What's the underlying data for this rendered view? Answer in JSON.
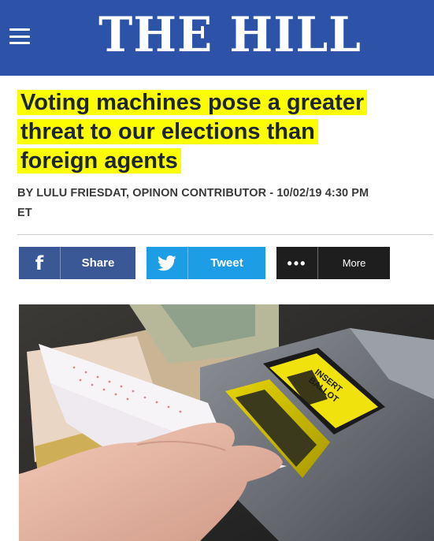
{
  "header": {
    "logo_text": "THE HILL",
    "background_color": "#2c53a7",
    "menu_icon": "hamburger-menu-icon"
  },
  "article": {
    "headline_lines": [
      "Voting machines pose a greater",
      "threat to our elections than",
      "foreign agents"
    ],
    "highlight_color": "#fbfd00",
    "byline_line1": "BY LULU FRIESDAT, OPINON CONTRIBUTOR - 10/02/19 4:30 PM",
    "byline_line2": "ET"
  },
  "share_buttons": [
    {
      "label": "Share",
      "icon": "facebook-icon",
      "color": "#3a5796"
    },
    {
      "label": "Tweet",
      "icon": "twitter-bird-icon",
      "color": "#1d9de6"
    },
    {
      "label": "More",
      "icon": "more-dots-icon",
      "color": "#1e1e1e"
    }
  ],
  "photo": {
    "sign_text": "INSERT BALLOT"
  }
}
